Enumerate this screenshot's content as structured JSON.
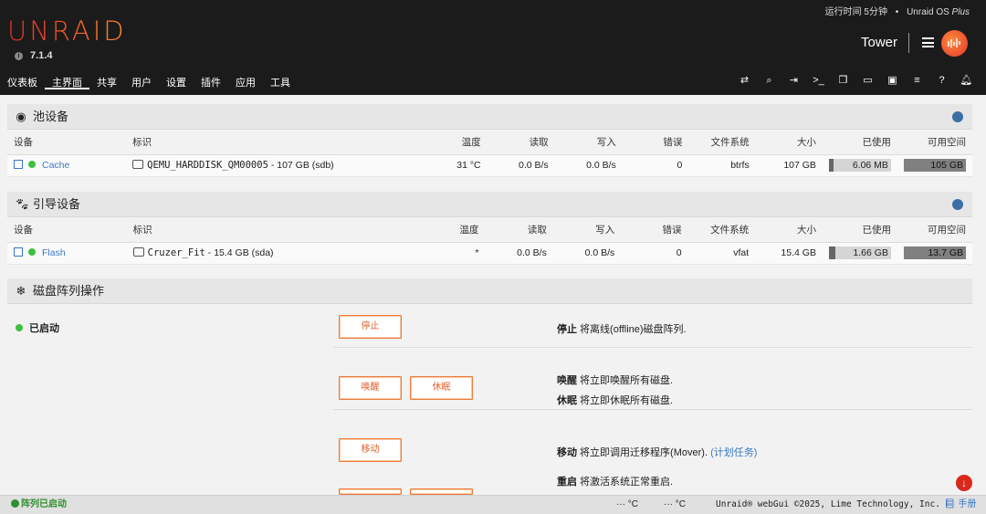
{
  "header": {
    "uptime": "运行时间 5分钟",
    "os_name": "Unraid OS",
    "os_edition": "Plus",
    "logo": "UNRAID",
    "version": "7.1.4",
    "server_name": "Tower"
  },
  "nav": {
    "items": [
      "仪表板",
      "主界面",
      "共享",
      "用户",
      "设置",
      "插件",
      "应用",
      "工具"
    ],
    "active": "主界面"
  },
  "pool": {
    "title": "池设备",
    "columns": [
      "设备",
      "标识",
      "温度",
      "读取",
      "写入",
      "错误",
      "文件系统",
      "大小",
      "已使用",
      "可用空间"
    ],
    "rows": [
      {
        "device": "Cache",
        "id": "QEMU_HARDDISK_QM00005",
        "id_suffix": " - 107 GB (sdb)",
        "temp": "31 °C",
        "read": "0.0 B/s",
        "write": "0.0 B/s",
        "errors": "0",
        "fs": "btrfs",
        "size": "107 GB",
        "used": "6.06 MB",
        "free": "105 GB",
        "used_fraction": 0.01,
        "free_fraction": 0.98
      }
    ]
  },
  "boot": {
    "title": "引导设备",
    "columns": [
      "设备",
      "标识",
      "温度",
      "读取",
      "写入",
      "错误",
      "文件系统",
      "大小",
      "已使用",
      "可用空间"
    ],
    "rows": [
      {
        "device": "Flash",
        "id": "Cruzer_Fit",
        "id_suffix": " - 15.4 GB (sda)",
        "temp": "*",
        "read": "0.0 B/s",
        "write": "0.0 B/s",
        "errors": "0",
        "fs": "vfat",
        "size": "15.4 GB",
        "used": "1.66 GB",
        "free": "13.7 GB",
        "used_fraction": 0.11,
        "free_fraction": 0.89
      }
    ]
  },
  "array_ops": {
    "title": "磁盘阵列操作",
    "status": "已启动",
    "stop_button": "停止",
    "stop_desc_bold": "停止",
    "stop_desc": " 将离线(offline)磁盘阵列.",
    "spinup_button": "唤醒",
    "spindown_button": "休眠",
    "spinup_desc_bold": "唤醒",
    "spinup_desc": " 将立即唤醒所有磁盘.",
    "spindown_desc_bold": "休眠",
    "spindown_desc": " 将立即休眠所有磁盘.",
    "move_button": "移动",
    "move_desc_bold": "移动",
    "move_desc": " 将立即调用迁移程序(Mover). ",
    "move_link": "(计划任务)",
    "reboot_desc_bold": "重启",
    "reboot_desc": " 将激活系统正常重启."
  },
  "footer": {
    "array_status": "阵列已启动",
    "temp1": "··· °C",
    "temp2": "··· °C",
    "copyright": "Unraid® webGui ©2025, Lime Technology, Inc.",
    "manual": "手册"
  },
  "colors": {
    "accent": "#ef7b38",
    "link": "#3b79c4",
    "online": "#3fbf3f",
    "header_bg": "#1c1b1b"
  }
}
